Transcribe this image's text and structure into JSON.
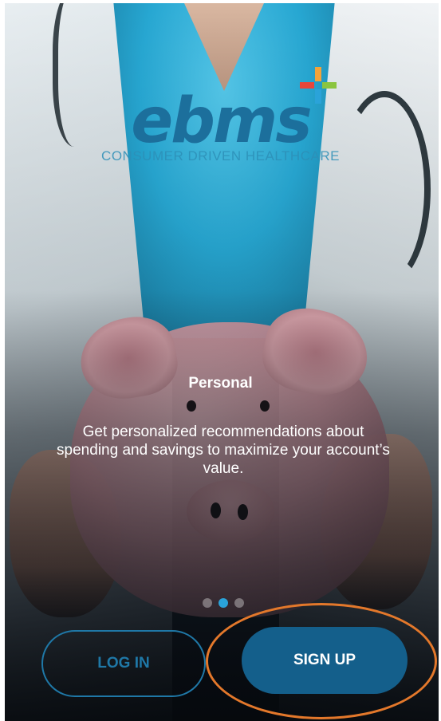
{
  "logo": {
    "wordmark": "ebms",
    "tagline": "CONSUMER DRIVEN HEALTHCARE",
    "plus_colors": [
      "#f2a33a",
      "#8bc53f",
      "#2aa3d9",
      "#e8463a"
    ]
  },
  "slide": {
    "title": "Personal",
    "body": "Get personalized recommendations about spending and savings to maximize your account’s value.",
    "dots_total": 3,
    "dots_active_index": 1
  },
  "buttons": {
    "login_label": "LOG IN",
    "signup_label": "SIGN UP"
  },
  "colors": {
    "brand_blue": "#1c6f9c",
    "signup_bg": "#145f8b",
    "highlight": "#e3782b",
    "dot_active": "#2aa3d9"
  }
}
